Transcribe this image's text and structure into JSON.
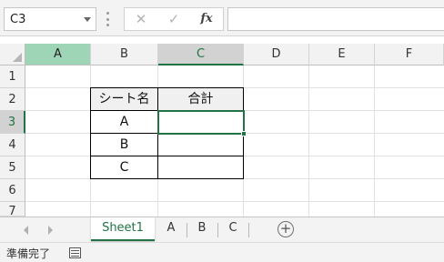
{
  "formula_bar": {
    "name_box": "C3",
    "cancel_glyph": "✕",
    "enter_glyph": "✓",
    "fx_glyph": "fx",
    "formula": ""
  },
  "columns": [
    "A",
    "B",
    "C",
    "D",
    "E",
    "F"
  ],
  "rows": [
    "1",
    "2",
    "3",
    "4",
    "5",
    "6",
    "7"
  ],
  "table": {
    "header_b": "シート名",
    "header_c": "合計",
    "rows": [
      {
        "name": "A",
        "total": ""
      },
      {
        "name": "B",
        "total": ""
      },
      {
        "name": "C",
        "total": ""
      }
    ]
  },
  "sheet_tabs": [
    "Sheet1",
    "A",
    "B",
    "C"
  ],
  "active_sheet": "Sheet1",
  "add_sheet_glyph": "+",
  "status": {
    "ready_text": "準備完了"
  },
  "colors": {
    "accent": "#217346",
    "selected_header": "#d2d2d2",
    "highlight_header": "#9fd5b7"
  }
}
